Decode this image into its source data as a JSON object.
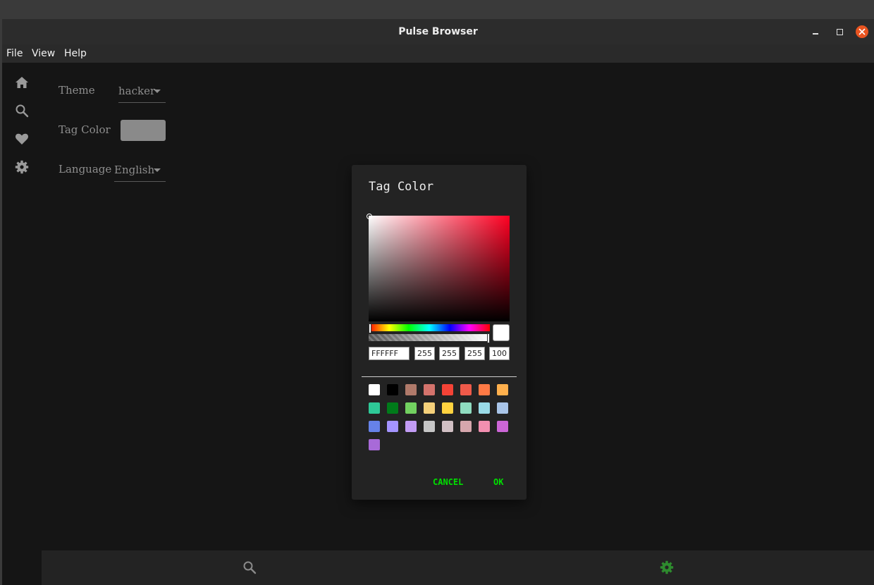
{
  "window": {
    "title": "Pulse Browser",
    "buttons": [
      "minimize",
      "maximize",
      "close"
    ]
  },
  "menu": {
    "items": [
      "File",
      "View",
      "Help"
    ]
  },
  "sidebar": {
    "icons": [
      "home-icon",
      "search-icon",
      "heart-icon",
      "gear-icon"
    ]
  },
  "settings": {
    "theme_label": "Theme",
    "theme_value": "hacker",
    "tag_color_label": "Tag Color",
    "tag_color_value": "#8a8a8a",
    "language_label": "Language",
    "language_value": "English"
  },
  "color_dialog": {
    "title": "Tag Color",
    "hex": "FFFFFF",
    "r": "255",
    "g": "255",
    "b": "255",
    "a": "100",
    "base_hue_color": "#ff0022",
    "presets": [
      "#ffffff",
      "#000000",
      "#b07a6a",
      "#d4736c",
      "#f44336",
      "#ef5a4a",
      "#ff7a45",
      "#ffb04d",
      "#2ec997",
      "#007b1a",
      "#72d160",
      "#f4d07a",
      "#ffd23f",
      "#8fdcc0",
      "#9adbe8",
      "#a9c5e8",
      "#6682e8",
      "#a494ff",
      "#c29cf4",
      "#c6c6c6",
      "#d1c0c4",
      "#d6a7ad",
      "#f28fb0",
      "#cc66d6",
      "#a86ad8"
    ],
    "cancel_label": "CANCEL",
    "ok_label": "OK",
    "accent_color": "#00e000"
  },
  "bottom_nav": {
    "icons": [
      "search-icon",
      "gear-icon"
    ],
    "active": "gear-icon",
    "active_color": "#2e8b2e"
  }
}
